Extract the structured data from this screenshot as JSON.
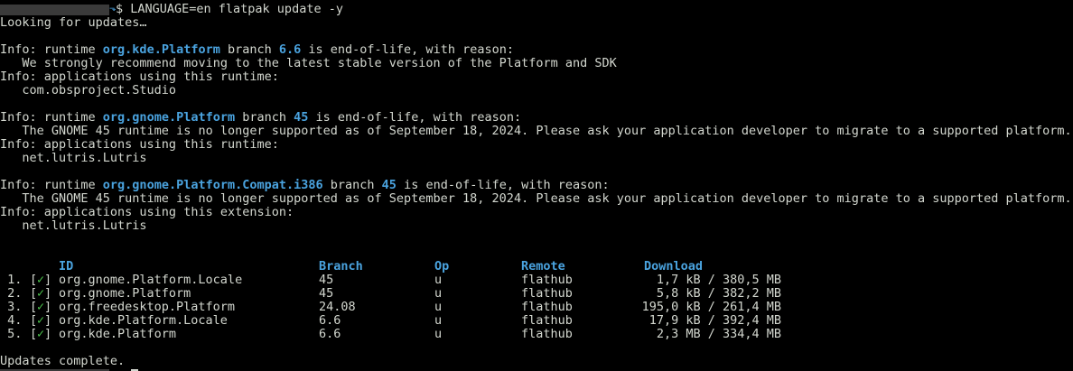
{
  "prompt": {
    "arrow": "⬎",
    "command": "$ LANGUAGE=en flatpak update -y"
  },
  "status": {
    "looking": "Looking for updates…",
    "complete": "Updates complete."
  },
  "eol": [
    {
      "kind": "runtime",
      "ref": "org.kde.Platform",
      "branch": "6.6",
      "reason": "   We strongly recommend moving to the latest stable version of the Platform and SDK",
      "apps_label": "Info: applications using this runtime:",
      "app": "   com.obsproject.Studio"
    },
    {
      "kind": "runtime",
      "ref": "org.gnome.Platform",
      "branch": "45",
      "reason": "   The GNOME 45 runtime is no longer supported as of September 18, 2024. Please ask your application developer to migrate to a supported platform.",
      "apps_label": "Info: applications using this runtime:",
      "app": "   net.lutris.Lutris"
    },
    {
      "kind": "runtime",
      "ref": "org.gnome.Platform.Compat.i386",
      "branch": "45",
      "reason": "   The GNOME 45 runtime is no longer supported as of September 18, 2024. Please ask your application developer to migrate to a supported platform.",
      "apps_label": "Info: applications using this extension:",
      "app": "   net.lutris.Lutris"
    }
  ],
  "text": {
    "info_prefix": "Info: runtime ",
    "branch_word": " branch ",
    "eol_suffix": " is end-of-life, with reason:"
  },
  "table": {
    "headers": {
      "id": "ID",
      "branch": "Branch",
      "op": "Op",
      "remote": "Remote",
      "download": "Download"
    },
    "rows": [
      {
        "num": " 1.",
        "check": "✓",
        "id": "org.gnome.Platform.Locale",
        "branch": "45",
        "op": "u",
        "remote": "flathub",
        "download": "1,7 kB / 380,5 MB"
      },
      {
        "num": " 2.",
        "check": "✓",
        "id": "org.gnome.Platform",
        "branch": "45",
        "op": "u",
        "remote": "flathub",
        "download": "5,8 kB / 382,2 MB"
      },
      {
        "num": " 3.",
        "check": "✓",
        "id": "org.freedesktop.Platform",
        "branch": "24.08",
        "op": "u",
        "remote": "flathub",
        "download": "195,0 kB / 261,4 MB"
      },
      {
        "num": " 4.",
        "check": "✓",
        "id": "org.kde.Platform.Locale",
        "branch": "6.6",
        "op": "u",
        "remote": "flathub",
        "download": "17,9 kB / 392,4 MB"
      },
      {
        "num": " 5.",
        "check": "✓",
        "id": "org.kde.Platform",
        "branch": "6.6",
        "op": "u",
        "remote": "flathub",
        "download": "2,3 MB / 334,4 MB"
      }
    ]
  },
  "colors": {
    "background": "#000000",
    "foreground": "#d3d7cf",
    "highlight": "#4aa3df",
    "check": "#4ec94e"
  }
}
